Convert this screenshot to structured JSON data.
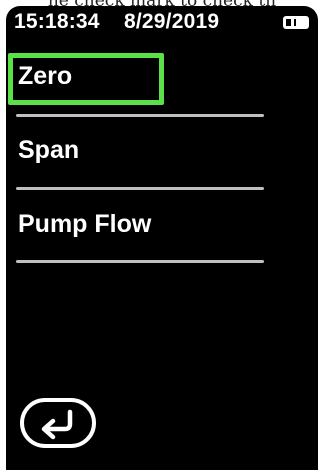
{
  "caption": "ne check mark to check th",
  "status_bar": {
    "time": "15:18:34",
    "date": "8/29/2019",
    "battery_icon": "battery-icon"
  },
  "menu": {
    "selected_item": "Zero",
    "items": [
      {
        "label": "Zero"
      },
      {
        "label": "Span"
      },
      {
        "label": "Pump Flow"
      }
    ]
  },
  "back_button": {
    "icon": "return-arrow-icon"
  },
  "colors": {
    "screen_background": "#000000",
    "text": "#ffffff",
    "selection_highlight": "#5be04a",
    "divider": "#bfbfbf"
  }
}
